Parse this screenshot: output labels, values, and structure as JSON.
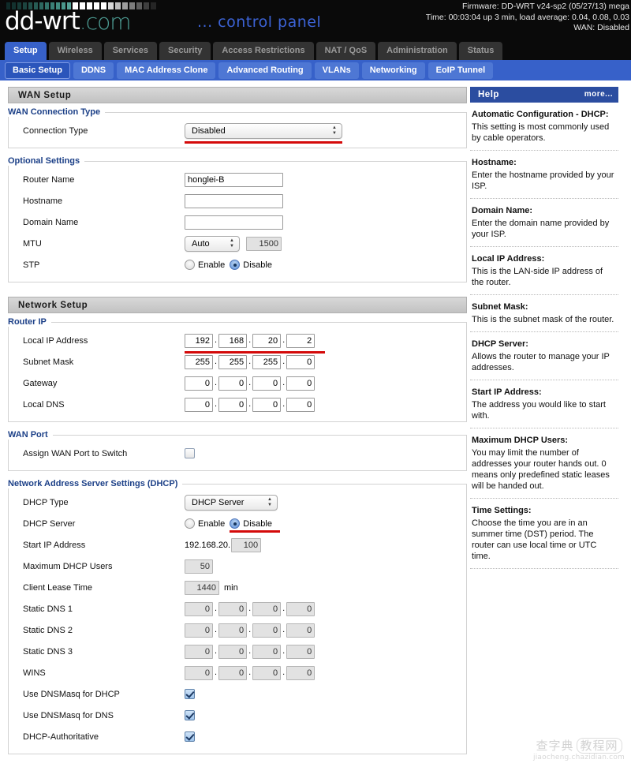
{
  "header": {
    "logo_main": "dd-wrt",
    "logo_suffix": ".com",
    "control_panel": "... control panel",
    "firmware": "Firmware: DD-WRT v24-sp2 (05/27/13) mega",
    "time": "Time: 00:03:04 up 3 min, load average: 0.04, 0.08, 0.03",
    "wan": "WAN: Disabled"
  },
  "tabs": [
    {
      "label": "Setup",
      "active": true
    },
    {
      "label": "Wireless",
      "active": false
    },
    {
      "label": "Services",
      "active": false
    },
    {
      "label": "Security",
      "active": false
    },
    {
      "label": "Access Restrictions",
      "active": false
    },
    {
      "label": "NAT / QoS",
      "active": false
    },
    {
      "label": "Administration",
      "active": false
    },
    {
      "label": "Status",
      "active": false
    }
  ],
  "subtabs": [
    {
      "label": "Basic Setup",
      "active": true
    },
    {
      "label": "DDNS",
      "active": false
    },
    {
      "label": "MAC Address Clone",
      "active": false
    },
    {
      "label": "Advanced Routing",
      "active": false
    },
    {
      "label": "VLANs",
      "active": false
    },
    {
      "label": "Networking",
      "active": false
    },
    {
      "label": "EoIP Tunnel",
      "active": false
    }
  ],
  "wan_setup": {
    "section_title": "WAN Setup",
    "connection_group": "WAN Connection Type",
    "connection_type_label": "Connection Type",
    "connection_type_value": "Disabled"
  },
  "optional": {
    "group": "Optional Settings",
    "router_name_label": "Router Name",
    "router_name_value": "honglei-B",
    "hostname_label": "Hostname",
    "hostname_value": "",
    "domain_name_label": "Domain Name",
    "domain_name_value": "",
    "mtu_label": "MTU",
    "mtu_mode": "Auto",
    "mtu_value": "1500",
    "stp_label": "STP",
    "stp_enable": "Enable",
    "stp_disable": "Disable",
    "stp_selected": "Disable"
  },
  "network_setup": {
    "section_title": "Network Setup",
    "router_ip_group": "Router IP",
    "local_ip_label": "Local IP Address",
    "local_ip": [
      "192",
      "168",
      "20",
      "2"
    ],
    "subnet_label": "Subnet Mask",
    "subnet": [
      "255",
      "255",
      "255",
      "0"
    ],
    "gateway_label": "Gateway",
    "gateway": [
      "0",
      "0",
      "0",
      "0"
    ],
    "local_dns_label": "Local DNS",
    "local_dns": [
      "0",
      "0",
      "0",
      "0"
    ]
  },
  "wan_port": {
    "group": "WAN Port",
    "assign_label": "Assign WAN Port to Switch",
    "assign_checked": false
  },
  "dhcp": {
    "group": "Network Address Server Settings (DHCP)",
    "dhcp_type_label": "DHCP Type",
    "dhcp_type_value": "DHCP Server",
    "dhcp_server_label": "DHCP Server",
    "dhcp_server_enable": "Enable",
    "dhcp_server_disable": "Disable",
    "dhcp_server_selected": "Disable",
    "start_ip_label": "Start IP Address",
    "start_ip_prefix": "192.168.20.",
    "start_ip_value": "100",
    "max_users_label": "Maximum DHCP Users",
    "max_users_value": "50",
    "lease_label": "Client Lease Time",
    "lease_value": "1440",
    "lease_unit": "min",
    "static_dns1_label": "Static DNS 1",
    "static_dns1": [
      "0",
      "0",
      "0",
      "0"
    ],
    "static_dns2_label": "Static DNS 2",
    "static_dns2": [
      "0",
      "0",
      "0",
      "0"
    ],
    "static_dns3_label": "Static DNS 3",
    "static_dns3": [
      "0",
      "0",
      "0",
      "0"
    ],
    "wins_label": "WINS",
    "wins": [
      "0",
      "0",
      "0",
      "0"
    ],
    "dnsmasq_dhcp_label": "Use DNSMasq for DHCP",
    "dnsmasq_dhcp_checked": true,
    "dnsmasq_dns_label": "Use DNSMasq for DNS",
    "dnsmasq_dns_checked": true,
    "authoritative_label": "DHCP-Authoritative",
    "authoritative_checked": true
  },
  "help": {
    "title": "Help",
    "more": "more...",
    "items": [
      {
        "heading": "Automatic Configuration - DHCP:",
        "body": "This setting is most commonly used by cable operators."
      },
      {
        "heading": "Hostname:",
        "body": "Enter the hostname provided by your ISP."
      },
      {
        "heading": "Domain Name:",
        "body": "Enter the domain name provided by your ISP."
      },
      {
        "heading": "Local IP Address:",
        "body": "This is the LAN-side IP address of the router."
      },
      {
        "heading": "Subnet Mask:",
        "body": "This is the subnet mask of the router."
      },
      {
        "heading": "DHCP Server:",
        "body": "Allows the router to manage your IP addresses."
      },
      {
        "heading": "Start IP Address:",
        "body": "The address you would like to start with."
      },
      {
        "heading": "Maximum DHCP Users:",
        "body": "You may limit the number of addresses your router hands out. 0 means only predefined static leases will be handed out."
      },
      {
        "heading": "Time Settings:",
        "body": "Choose the time you are in an summer time (DST) period. The router can use local time or UTC time."
      }
    ]
  },
  "watermark": {
    "cn_left": "查字典",
    "cn_right": "教程网",
    "url": "jiaocheng.chazidian.com"
  },
  "colors": {
    "accent_blue": "#3761c9",
    "header_black": "#0a0a0a",
    "logo_teal": "#4e9f96",
    "highlight_red": "#d40a0a",
    "help_blue": "#2b4da0"
  }
}
